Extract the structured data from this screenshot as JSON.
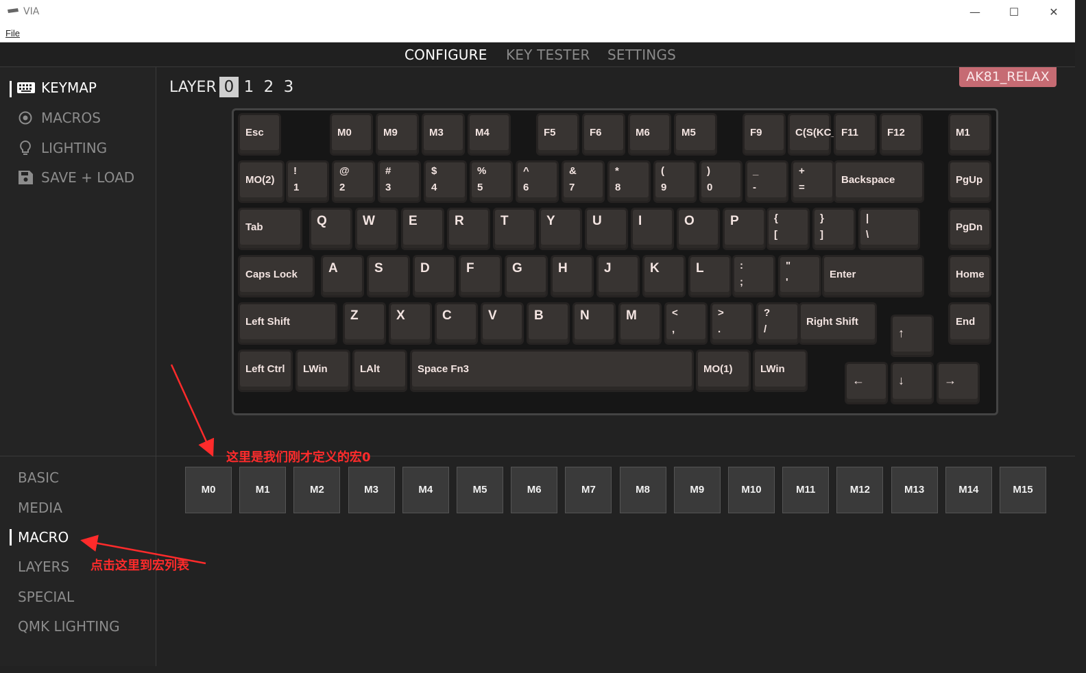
{
  "window": {
    "title": "VIA",
    "menu_file": "File",
    "minimize": "—",
    "maximize": "☐",
    "close": "✕"
  },
  "topnav": {
    "tabs": [
      {
        "label": "CONFIGURE",
        "active": true
      },
      {
        "label": "KEY TESTER",
        "active": false
      },
      {
        "label": "SETTINGS",
        "active": false
      }
    ]
  },
  "sidebar": {
    "items": [
      {
        "label": "KEYMAP",
        "icon": "keyboard-icon",
        "active": true
      },
      {
        "label": "MACROS",
        "icon": "record-icon",
        "active": false
      },
      {
        "label": "LIGHTING",
        "icon": "lightbulb-icon",
        "active": false
      },
      {
        "label": "SAVE + LOAD",
        "icon": "floppy-disk-icon",
        "active": false
      }
    ]
  },
  "categories": {
    "items": [
      {
        "label": "BASIC",
        "active": false
      },
      {
        "label": "MEDIA",
        "active": false
      },
      {
        "label": "MACRO",
        "active": true
      },
      {
        "label": "LAYERS",
        "active": false
      },
      {
        "label": "SPECIAL",
        "active": false
      },
      {
        "label": "QMK LIGHTING",
        "active": false
      }
    ]
  },
  "layers": {
    "label": "LAYER",
    "values": [
      "0",
      "1",
      "2",
      "3"
    ],
    "selected": "0"
  },
  "device": {
    "name": "AK81_RELAX"
  },
  "keyboard": {
    "row0": [
      "Esc",
      "M0",
      "M9",
      "M3",
      "M4",
      "F5",
      "F6",
      "M6",
      "M5",
      "F9",
      "C(S(KC_",
      "F11",
      "F12",
      "M1"
    ],
    "row1": {
      "first": "MO(2)",
      "pairs": [
        [
          "!",
          "1"
        ],
        [
          "@",
          "2"
        ],
        [
          "#",
          "3"
        ],
        [
          "$",
          "4"
        ],
        [
          "%",
          "5"
        ],
        [
          "^",
          "6"
        ],
        [
          "&",
          "7"
        ],
        [
          "*",
          "8"
        ],
        [
          "(",
          "9"
        ],
        [
          ")",
          "0"
        ],
        [
          "_",
          "-"
        ],
        [
          "+",
          "="
        ]
      ],
      "backspace": "Backspace",
      "last": "PgUp"
    },
    "row2": {
      "first": "Tab",
      "letters": [
        "Q",
        "W",
        "E",
        "R",
        "T",
        "Y",
        "U",
        "I",
        "O",
        "P"
      ],
      "pairs": [
        [
          "{",
          "["
        ],
        [
          "}",
          "]"
        ],
        [
          "|",
          "\\"
        ]
      ],
      "last": "PgDn"
    },
    "row3": {
      "first": "Caps Lock",
      "letters": [
        "A",
        "S",
        "D",
        "F",
        "G",
        "H",
        "J",
        "K",
        "L"
      ],
      "pairs": [
        [
          ":",
          ";"
        ],
        [
          "\"",
          "'"
        ]
      ],
      "enter": "Enter",
      "last": "Home"
    },
    "row4": {
      "first": "Left Shift",
      "letters": [
        "Z",
        "X",
        "C",
        "V",
        "B",
        "N",
        "M"
      ],
      "pairs": [
        [
          "<",
          ","
        ],
        [
          ">",
          "."
        ],
        [
          "?",
          "/"
        ]
      ],
      "rshift": "Right Shift",
      "last": "End"
    },
    "row5": [
      "Left Ctrl",
      "LWin",
      "LAlt",
      "Space Fn3",
      "MO(1)",
      "LWin"
    ],
    "arrows": {
      "up": "↑",
      "left": "←",
      "down": "↓",
      "right": "→"
    }
  },
  "macro_palette": [
    "M0",
    "M1",
    "M2",
    "M3",
    "M4",
    "M5",
    "M6",
    "M7",
    "M8",
    "M9",
    "M10",
    "M11",
    "M12",
    "M13",
    "M14",
    "M15"
  ],
  "annotations": {
    "macro0_note": "这里是我们刚才定义的宏0",
    "macro_list_note": "点击这里到宏列表"
  },
  "colors": {
    "background": "#222222",
    "badge": "#c66b73",
    "keycap": "#383432",
    "annotation": "#ff2b2b"
  }
}
